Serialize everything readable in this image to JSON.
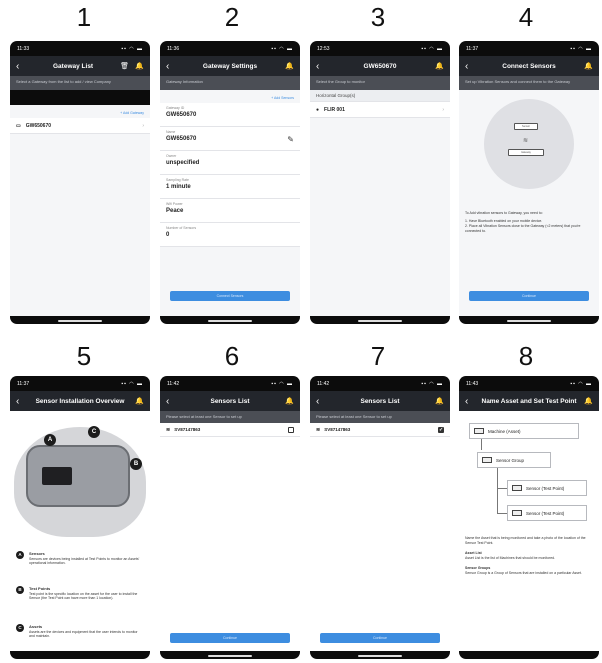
{
  "steps": [
    "1",
    "2",
    "3",
    "4",
    "5",
    "6",
    "7",
    "8"
  ],
  "screens": {
    "s1": {
      "time": "11:33",
      "title": "Gateway List",
      "subtitle": "Select a Gateway from the list to add / view Company",
      "add_link": "+ Add Gateway",
      "items": [
        "GW650670"
      ]
    },
    "s2": {
      "time": "11:36",
      "title": "Gateway Settings",
      "subtitle": "Gateway Information",
      "link": "+ Add Sensors",
      "fields": [
        {
          "label": "Gateway ID",
          "value": "GW650670"
        },
        {
          "label": "Name",
          "value": "GW650670"
        },
        {
          "label": "Owner",
          "value": "unspecified"
        },
        {
          "label": "Sampling Rate",
          "value": "1 minute"
        },
        {
          "label": "Wifi Power",
          "value": "Peace"
        },
        {
          "label": "Number of Sensors",
          "value": "0"
        }
      ],
      "button": "Connect Sensors"
    },
    "s3": {
      "time": "12:53",
      "title": "GW650670",
      "subtitle": "Select the Group to monitor",
      "group_header": "Horizontal Group(s)",
      "items": [
        "FLIR 001"
      ]
    },
    "s4": {
      "time": "11:37",
      "title": "Connect Sensors",
      "subtitle": "Set up Vibration Sensors and connect them to the Gateway",
      "device_top": "Sensor",
      "device_bottom": "Gateway",
      "text": "To Add vibration sensors to Gateway, you need to:",
      "steps_text": [
        "1. Have Bluetooth enabled on your mobile device.",
        "2. Place all Vibration Sensors close to the Gateway (<2 meters) that you're connected to."
      ],
      "button": "Continue"
    },
    "s5": {
      "time": "11:37",
      "title": "Sensor Installation Overview",
      "pins": [
        "A",
        "C",
        "B"
      ],
      "legend": [
        {
          "badge": "A",
          "title": "Sensors",
          "desc": "Sensors are devices being installed at Test Points to monitor an Assets' operational information."
        },
        {
          "badge": "B",
          "title": "Test Points",
          "desc": "Test point is the specific location on the asset for the user to install the Sensor (the Test Point can have more than 1 location)."
        },
        {
          "badge": "C",
          "title": "Assets",
          "desc": "Assets are the devices and equipment that the user intends to monitor and maintain."
        }
      ]
    },
    "s6": {
      "time": "11:42",
      "title": "Sensors List",
      "subtitle": "Please select at least one Sensor to set up",
      "items": [
        {
          "label": "SV87147863",
          "checked": false
        }
      ],
      "button": "Continue"
    },
    "s7": {
      "time": "11:42",
      "title": "Sensors List",
      "subtitle": "Please select at least one Sensor to set up",
      "items": [
        {
          "label": "SV87147863",
          "checked": true
        }
      ],
      "button": "Continue"
    },
    "s8": {
      "time": "11:43",
      "title": "Name Asset and Set Test Point",
      "tree": [
        "Machine (Asset)",
        "Sensor Group",
        "Sensor (Test Point)",
        "Sensor (Test Point)"
      ],
      "text1": "Name the Asset that is being monitored and take a photo of the location of the Sensor Test Point.",
      "asset_title": "Asset List",
      "asset_desc": "Asset List is the list of Machines that should be monitored.",
      "group_title": "Sensor Groups",
      "group_desc": "Sensor Group is a Group of Sensors that are installed on a particular Asset."
    }
  },
  "colors": {
    "accent": "#3d8de0",
    "navbar": "#23262c",
    "subbar": "#4b4e55",
    "alert": "#ff6a3d"
  },
  "icons": {
    "back": "chevron-left",
    "bell": "bell-icon",
    "trash": "trash-icon",
    "router": "router-icon",
    "wifi": "wifi-icon",
    "pencil": "pencil-icon"
  }
}
